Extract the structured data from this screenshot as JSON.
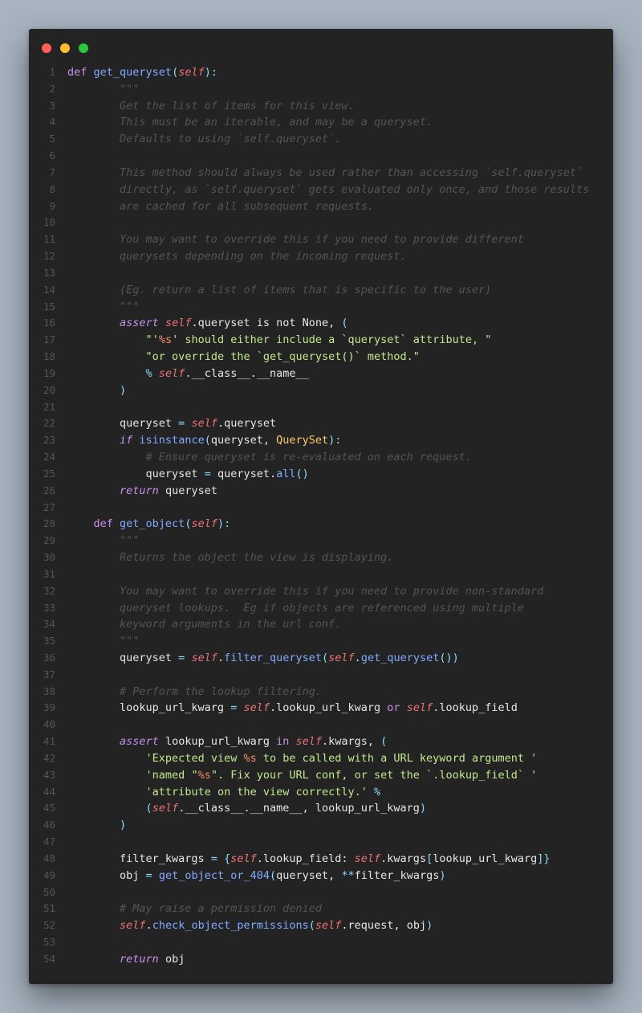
{
  "window": {
    "controls": [
      "close",
      "minimize",
      "zoom"
    ],
    "colors": {
      "background": "#232323",
      "close": "#fe5f57",
      "minimize": "#febc2e",
      "zoom": "#28c840"
    }
  },
  "code": {
    "language": "python",
    "lines": [
      [
        [
          "kw",
          "def "
        ],
        [
          "fn",
          "get_queryset"
        ],
        [
          "pu",
          "("
        ],
        [
          "self",
          "self"
        ],
        [
          "pu",
          "):"
        ]
      ],
      [
        [
          "cm",
          "        \"\"\""
        ]
      ],
      [
        [
          "cm",
          "        Get the list of items for this view."
        ]
      ],
      [
        [
          "cm",
          "        This must be an iterable, and may be a queryset."
        ]
      ],
      [
        [
          "cm",
          "        Defaults to using `self.queryset`."
        ]
      ],
      [],
      [
        [
          "cm",
          "        This method should always be used rather than accessing `self.queryset`"
        ]
      ],
      [
        [
          "cm",
          "        directly, as `self.queryset` gets evaluated only once, and those results"
        ]
      ],
      [
        [
          "cm",
          "        are cached for all subsequent requests."
        ]
      ],
      [],
      [
        [
          "cm",
          "        You may want to override this if you need to provide different"
        ]
      ],
      [
        [
          "cm",
          "        querysets depending on the incoming request."
        ]
      ],
      [],
      [
        [
          "cm",
          "        (Eg. return a list of items that is specific to the user)"
        ]
      ],
      [
        [
          "cm",
          "        \"\"\""
        ]
      ],
      [
        [
          "pl",
          "        "
        ],
        [
          "kwi",
          "assert "
        ],
        [
          "self",
          "self"
        ],
        [
          "pl",
          ".queryset "
        ],
        [
          "pl",
          "is not "
        ],
        [
          "pl",
          "None"
        ],
        [
          "pl",
          ", "
        ],
        [
          "pu",
          "("
        ]
      ],
      [
        [
          "pl",
          "            "
        ],
        [
          "st",
          "\"'"
        ],
        [
          "fmt",
          "%s"
        ],
        [
          "st",
          "' should either include a `queryset` attribute, \""
        ]
      ],
      [
        [
          "pl",
          "            "
        ],
        [
          "st",
          "\"or override the `get_queryset()` method.\""
        ]
      ],
      [
        [
          "pl",
          "            "
        ],
        [
          "op",
          "% "
        ],
        [
          "self",
          "self"
        ],
        [
          "pl",
          ".__class__.__name__"
        ]
      ],
      [
        [
          "pl",
          "        "
        ],
        [
          "pu",
          ")"
        ]
      ],
      [],
      [
        [
          "pl",
          "        queryset "
        ],
        [
          "op",
          "= "
        ],
        [
          "self",
          "self"
        ],
        [
          "pl",
          ".queryset"
        ]
      ],
      [
        [
          "pl",
          "        "
        ],
        [
          "kwi",
          "if "
        ],
        [
          "bi",
          "isinstance"
        ],
        [
          "pu",
          "("
        ],
        [
          "pl",
          "queryset, "
        ],
        [
          "cls",
          "QuerySet"
        ],
        [
          "pu",
          "):"
        ]
      ],
      [
        [
          "cm",
          "            # Ensure queryset is re-evaluated on each request."
        ]
      ],
      [
        [
          "pl",
          "            queryset "
        ],
        [
          "op",
          "= "
        ],
        [
          "pl",
          "queryset."
        ],
        [
          "fn",
          "all"
        ],
        [
          "pu",
          "()"
        ]
      ],
      [
        [
          "pl",
          "        "
        ],
        [
          "kwi",
          "return "
        ],
        [
          "pl",
          "queryset"
        ]
      ],
      [],
      [
        [
          "kw",
          "    def "
        ],
        [
          "fn",
          "get_object"
        ],
        [
          "pu",
          "("
        ],
        [
          "self",
          "self"
        ],
        [
          "pu",
          "):"
        ]
      ],
      [
        [
          "cm",
          "        \"\"\""
        ]
      ],
      [
        [
          "cm",
          "        Returns the object the view is displaying."
        ]
      ],
      [],
      [
        [
          "cm",
          "        You may want to override this if you need to provide non-standard"
        ]
      ],
      [
        [
          "cm",
          "        queryset lookups.  Eg if objects are referenced using multiple"
        ]
      ],
      [
        [
          "cm",
          "        keyword arguments in the url conf."
        ]
      ],
      [
        [
          "cm",
          "        \"\"\""
        ]
      ],
      [
        [
          "pl",
          "        queryset "
        ],
        [
          "op",
          "= "
        ],
        [
          "self",
          "self"
        ],
        [
          "pl",
          "."
        ],
        [
          "fn",
          "filter_queryset"
        ],
        [
          "pu",
          "("
        ],
        [
          "self",
          "self"
        ],
        [
          "pl",
          "."
        ],
        [
          "fn",
          "get_queryset"
        ],
        [
          "pu",
          "())"
        ]
      ],
      [],
      [
        [
          "cm",
          "        # Perform the lookup filtering."
        ]
      ],
      [
        [
          "pl",
          "        lookup_url_kwarg "
        ],
        [
          "op",
          "= "
        ],
        [
          "self",
          "self"
        ],
        [
          "pl",
          ".lookup_url_kwarg "
        ],
        [
          "kw",
          "or "
        ],
        [
          "self",
          "self"
        ],
        [
          "pl",
          ".lookup_field"
        ]
      ],
      [],
      [
        [
          "pl",
          "        "
        ],
        [
          "kwi",
          "assert "
        ],
        [
          "pl",
          "lookup_url_kwarg "
        ],
        [
          "kw",
          "in "
        ],
        [
          "self",
          "self"
        ],
        [
          "pl",
          ".kwargs, "
        ],
        [
          "pu",
          "("
        ]
      ],
      [
        [
          "pl",
          "            "
        ],
        [
          "st",
          "'Expected view "
        ],
        [
          "fmt",
          "%s"
        ],
        [
          "st",
          " to be called with a URL keyword argument '"
        ]
      ],
      [
        [
          "pl",
          "            "
        ],
        [
          "st",
          "'named \""
        ],
        [
          "fmt",
          "%s"
        ],
        [
          "st",
          "\". Fix your URL conf, or set the `.lookup_field` '"
        ]
      ],
      [
        [
          "pl",
          "            "
        ],
        [
          "st",
          "'attribute on the view correctly.' "
        ],
        [
          "op",
          "%"
        ]
      ],
      [
        [
          "pl",
          "            "
        ],
        [
          "pu",
          "("
        ],
        [
          "self",
          "self"
        ],
        [
          "pl",
          ".__class__.__name__, lookup_url_kwarg"
        ],
        [
          "pu",
          ")"
        ]
      ],
      [
        [
          "pl",
          "        "
        ],
        [
          "pu",
          ")"
        ]
      ],
      [],
      [
        [
          "pl",
          "        filter_kwargs "
        ],
        [
          "op",
          "= "
        ],
        [
          "pu",
          "{"
        ],
        [
          "self",
          "self"
        ],
        [
          "pl",
          ".lookup_field: "
        ],
        [
          "self",
          "self"
        ],
        [
          "pl",
          ".kwargs"
        ],
        [
          "pu",
          "["
        ],
        [
          "pl",
          "lookup_url_kwarg"
        ],
        [
          "pu",
          "]}"
        ]
      ],
      [
        [
          "pl",
          "        obj "
        ],
        [
          "op",
          "= "
        ],
        [
          "fn",
          "get_object_or_404"
        ],
        [
          "pu",
          "("
        ],
        [
          "pl",
          "queryset, "
        ],
        [
          "op",
          "**"
        ],
        [
          "pl",
          "filter_kwargs"
        ],
        [
          "pu",
          ")"
        ]
      ],
      [],
      [
        [
          "cm",
          "        # May raise a permission denied"
        ]
      ],
      [
        [
          "pl",
          "        "
        ],
        [
          "self",
          "self"
        ],
        [
          "pl",
          "."
        ],
        [
          "fn",
          "check_object_permissions"
        ],
        [
          "pu",
          "("
        ],
        [
          "self",
          "self"
        ],
        [
          "pl",
          ".request, obj"
        ],
        [
          "pu",
          ")"
        ]
      ],
      [],
      [
        [
          "pl",
          "        "
        ],
        [
          "kwi",
          "return "
        ],
        [
          "pl",
          "obj"
        ]
      ]
    ]
  }
}
